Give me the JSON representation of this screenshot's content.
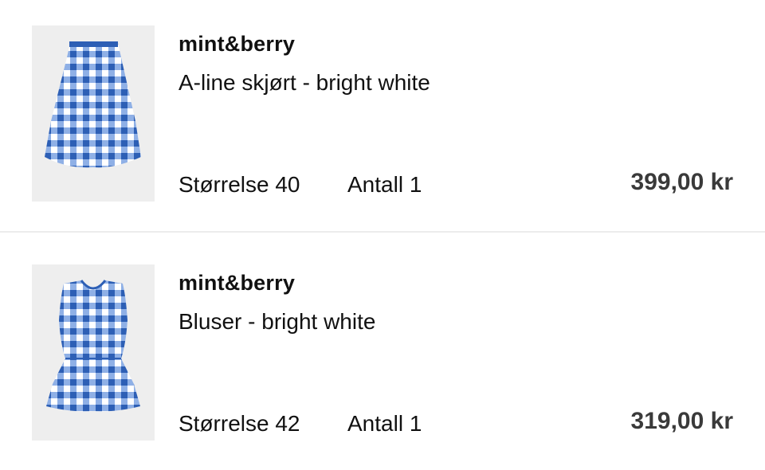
{
  "cart": {
    "items": [
      {
        "brand": "mint&berry",
        "title": "A-line skjørt - bright white",
        "size_text": "Størrelse 40",
        "quantity_text": "Antall 1",
        "price": "399,00 kr",
        "image": "blue-gingham-skirt"
      },
      {
        "brand": "mint&berry",
        "title": "Bluser - bright white",
        "size_text": "Størrelse 42",
        "quantity_text": "Antall 1",
        "price": "319,00 kr",
        "image": "blue-gingham-peplum-top"
      }
    ]
  },
  "colors": {
    "gingham_dark": "#2d5fb5",
    "gingham_light": "#8fb0e6",
    "thumb_bg": "#eeeeee",
    "divider": "#ececec",
    "price_text": "#3a3a3a"
  }
}
